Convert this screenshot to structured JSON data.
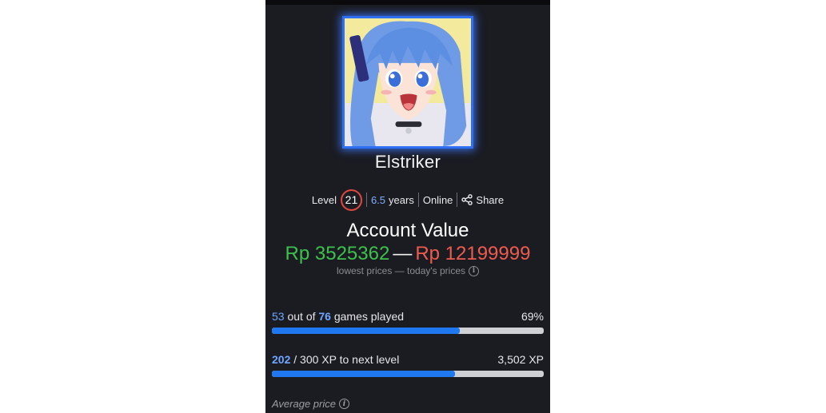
{
  "profile": {
    "username": "Elstriker",
    "level_label": "Level",
    "level": "21",
    "years_value": "6.5",
    "years_label": "years",
    "status": "Online",
    "share_label": "Share"
  },
  "account_value": {
    "title": "Account Value",
    "low_value": "Rp 3525362",
    "dash": "—",
    "high_value": "Rp 12199999",
    "note": "lowest prices — today's prices"
  },
  "games_progress": {
    "played": "53",
    "out_of_label": "out of",
    "total": "76",
    "suffix": "games played",
    "percent_label": "69%",
    "fraction": 0.69
  },
  "xp_progress": {
    "current": "202",
    "rest_label": "/ 300 XP to next level",
    "total_xp": "3,502 XP",
    "fraction": 0.673
  },
  "average_price": {
    "label": "Average price"
  },
  "icons": {
    "info": "info-icon",
    "share": "share-icon"
  },
  "colors": {
    "background": "#1b1c22",
    "accent_blue": "#1f78ef",
    "low_value_green": "#3cc24c",
    "high_value_red": "#ef5b4e",
    "level_ring": "#e0483d"
  }
}
